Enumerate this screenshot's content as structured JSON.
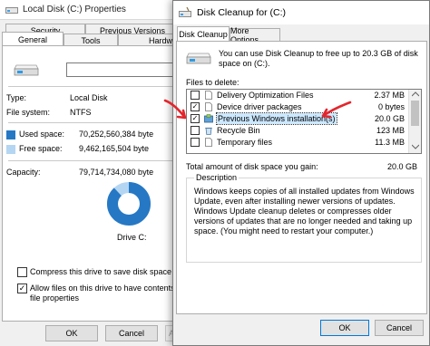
{
  "properties": {
    "title": "Local Disk (C:) Properties",
    "tabs_back": [
      "Security",
      "Previous Versions"
    ],
    "tabs_front": [
      "General",
      "Tools",
      "Hardwa"
    ],
    "type_label": "Type:",
    "type_value": "Local Disk",
    "fs_label": "File system:",
    "fs_value": "NTFS",
    "used_label": "Used space:",
    "used_value": "70,252,560,384 byte",
    "free_label": "Free space:",
    "free_value": "9,462,165,504 byte",
    "capacity_label": "Capacity:",
    "capacity_value": "79,714,734,080 byte",
    "drive_label": "Drive C:",
    "compress_label": "Compress this drive to save disk space",
    "index_label_1": "Allow files on this drive to have contents in",
    "index_label_2": "file properties",
    "ok": "OK",
    "cancel": "Cancel",
    "apply": "Apply",
    "used_fraction": 0.88,
    "used_color": "#2678c4",
    "free_color": "#b4d6f2"
  },
  "cleanup": {
    "title": "Disk Cleanup for  (C:)",
    "tabs": [
      "Disk Cleanup",
      "More Options"
    ],
    "intro_1": "You can use Disk Cleanup to free up to 20.3 GB of disk",
    "intro_2": "space on  (C:).",
    "files_label": "Files to delete:",
    "files": [
      {
        "name": "Delivery Optimization Files",
        "size": "2.37 MB",
        "checked": false,
        "icon": "file-icon"
      },
      {
        "name": "Device driver packages",
        "size": "0 bytes",
        "checked": true,
        "icon": "file-icon"
      },
      {
        "name": "Previous Windows installation(s)",
        "size": "20.0 GB",
        "checked": true,
        "icon": "windows-setup-icon"
      },
      {
        "name": "Recycle Bin",
        "size": "123 MB",
        "checked": false,
        "icon": "recycle-bin-icon"
      },
      {
        "name": "Temporary files",
        "size": "11.3 MB",
        "checked": false,
        "icon": "file-icon"
      }
    ],
    "total_label": "Total amount of disk space you gain:",
    "total_value": "20.0 GB",
    "description_legend": "Description",
    "description": "Windows keeps copies of all installed updates from Windows Update, even after installing newer versions of updates. Windows Update cleanup deletes or compresses older versions of updates that are no longer needed and taking up space. (You might need to restart your computer.)",
    "ok": "OK",
    "cancel": "Cancel",
    "accent_color": "#0078d7",
    "annotation_color": "#e3262d"
  }
}
